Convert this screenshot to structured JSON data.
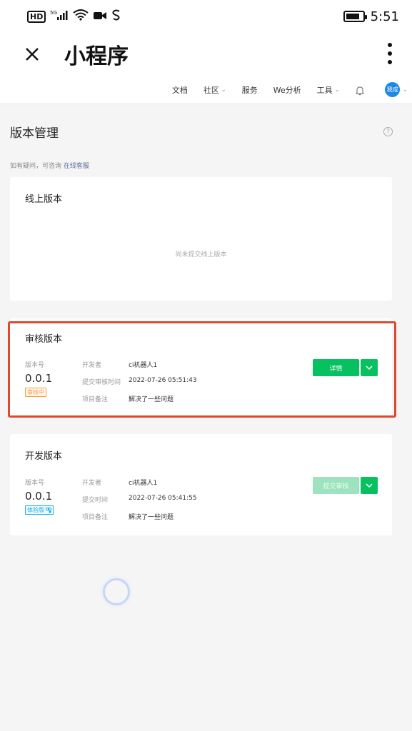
{
  "status_bar": {
    "hd_label": "HD",
    "network_label": "5G",
    "time": "5:51"
  },
  "title_bar": {
    "title": "小程序"
  },
  "nav": {
    "items": [
      "文档",
      "社区",
      "服务",
      "We分析",
      "工具"
    ],
    "avatar_text": "我成"
  },
  "page": {
    "title": "版本管理",
    "hint_prefix": "如有疑问，可咨询",
    "hint_link": "在线客服"
  },
  "online_card": {
    "title": "线上版本",
    "empty_text": "尚未提交线上版本"
  },
  "review_card": {
    "title": "审核版本",
    "version_label": "版本号",
    "version": "0.0.1",
    "status_tag": "审核中",
    "developer_label": "开发者",
    "developer": "ci机器人1",
    "time_label": "提交审核时间",
    "time": "2022-07-26 05:51:43",
    "note_label": "项目备注",
    "note": "解决了一些问题",
    "primary_button": "详情"
  },
  "dev_card": {
    "title": "开发版本",
    "version_label": "版本号",
    "version": "0.0.1",
    "status_tag": "体验版",
    "developer_label": "开发者",
    "developer": "ci机器人1",
    "time_label": "提交时间",
    "time": "2022-07-26 05:41:55",
    "note_label": "项目备注",
    "note": "解决了一些问题",
    "primary_button": "提交审核"
  },
  "colors": {
    "accent_green": "#07c160",
    "highlight_red": "#e2462d",
    "link_blue": "#576b95"
  }
}
